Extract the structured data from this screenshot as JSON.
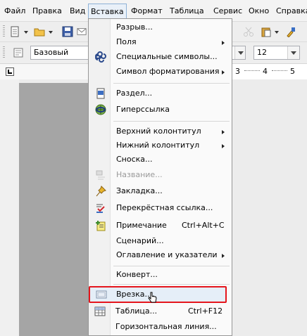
{
  "menubar": {
    "items": [
      {
        "label": "Файл"
      },
      {
        "label": "Правка"
      },
      {
        "label": "Вид"
      },
      {
        "label": "Вставка"
      },
      {
        "label": "Формат"
      },
      {
        "label": "Таблица"
      },
      {
        "label": "Сервис"
      },
      {
        "label": "Окно"
      },
      {
        "label": "Справка"
      }
    ]
  },
  "toolbar": {
    "style_value": "Базовый",
    "size_value": "12"
  },
  "ruler": {
    "ticks": [
      "3",
      "4",
      "5"
    ]
  },
  "insert_menu": {
    "items": [
      {
        "label": "Разрыв...",
        "icon": "",
        "submenu": false,
        "disabled": false
      },
      {
        "label": "Поля",
        "icon": "",
        "submenu": true,
        "disabled": false
      },
      {
        "label": "Специальные символы...",
        "icon": "omega-symbol-icon",
        "submenu": false,
        "disabled": false
      },
      {
        "label": "Символ форматирования",
        "icon": "",
        "submenu": true,
        "disabled": false
      },
      {
        "label": "Раздел...",
        "icon": "section-icon",
        "submenu": false,
        "disabled": false
      },
      {
        "label": "Гиперссылка",
        "icon": "hyperlink-globe-icon",
        "submenu": false,
        "disabled": false
      },
      {
        "label": "Верхний колонтитул",
        "icon": "",
        "submenu": true,
        "disabled": false
      },
      {
        "label": "Нижний колонтитул",
        "icon": "",
        "submenu": true,
        "disabled": false
      },
      {
        "label": "Сноска...",
        "icon": "",
        "submenu": false,
        "disabled": false
      },
      {
        "label": "Название...",
        "icon": "caption-icon",
        "submenu": false,
        "disabled": true
      },
      {
        "label": "Закладка...",
        "icon": "bookmark-pin-icon",
        "submenu": false,
        "disabled": false
      },
      {
        "label": "Перекрёстная ссылка...",
        "icon": "cross-reference-icon",
        "submenu": false,
        "disabled": false
      },
      {
        "label": "Примечание",
        "shortcut": "Ctrl+Alt+C",
        "icon": "comment-note-icon",
        "submenu": false,
        "disabled": false
      },
      {
        "label": "Сценарий...",
        "icon": "",
        "submenu": false,
        "disabled": false
      },
      {
        "label": "Оглавление и указатели",
        "icon": "",
        "submenu": true,
        "disabled": false
      },
      {
        "label": "Конверт...",
        "icon": "",
        "submenu": false,
        "disabled": false
      },
      {
        "label": "Врезка...",
        "icon": "frame-icon",
        "submenu": false,
        "disabled": false,
        "highlighted": true
      },
      {
        "label": "Таблица...",
        "shortcut": "Ctrl+F12",
        "icon": "table-grid-icon",
        "submenu": false,
        "disabled": false
      },
      {
        "label": "Горизонтальная линия...",
        "icon": "",
        "submenu": false,
        "disabled": false
      }
    ]
  },
  "colors": {
    "highlight_border": "#e5151c",
    "menu_bg": "#fafafa",
    "active_menu_bg": "#e9f0f8"
  }
}
